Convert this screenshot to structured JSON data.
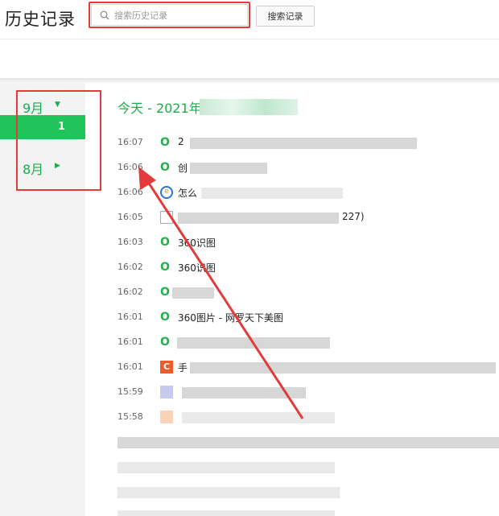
{
  "header": {
    "title": "历史记录",
    "search_placeholder": "搜索历史记录",
    "search_button": "搜索记录"
  },
  "sidebar": {
    "months": [
      {
        "label": "9月",
        "caret": "▼"
      },
      {
        "label": "8月",
        "caret": "▶"
      }
    ],
    "selected_day": "1"
  },
  "main": {
    "date_heading": "今天 - 2021年",
    "rows": [
      {
        "time": "16:07",
        "icon": "360-search-icon",
        "title": "2"
      },
      {
        "time": "16:06",
        "icon": "360-search-icon",
        "title": "创"
      },
      {
        "time": "16:06",
        "icon": "ie-browser-icon",
        "title": "怎么"
      },
      {
        "time": "16:05",
        "icon": "document-icon",
        "title": "227)"
      },
      {
        "time": "16:03",
        "icon": "360-search-icon",
        "title": "360识图"
      },
      {
        "time": "16:02",
        "icon": "360-search-icon",
        "title": "360识图"
      },
      {
        "time": "16:02",
        "icon": "360-search-icon",
        "title": ""
      },
      {
        "time": "16:01",
        "icon": "360-search-icon",
        "title": "360图片 - 网罗天下美图"
      },
      {
        "time": "16:01",
        "icon": "360-search-icon",
        "title": ""
      },
      {
        "time": "16:01",
        "icon": "c-site-icon",
        "title": "手"
      },
      {
        "time": "15:59",
        "icon": "blurred-icon",
        "title": ""
      },
      {
        "time": "15:58",
        "icon": "blurred-icon",
        "title": ""
      }
    ]
  },
  "colors": {
    "accent_green": "#1aad4b",
    "selected_bg": "#1fc45a",
    "annotation_red": "#e33b3b"
  }
}
